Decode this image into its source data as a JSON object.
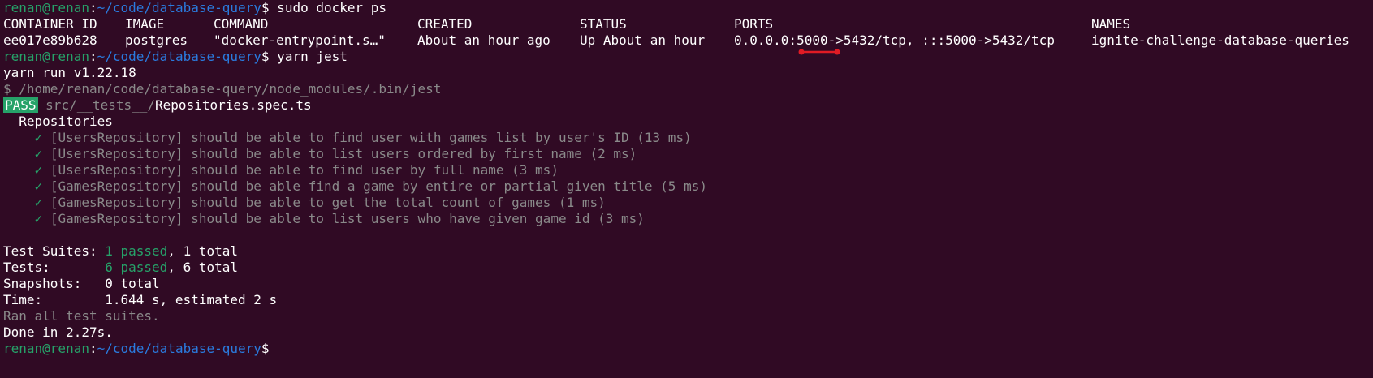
{
  "prompt": {
    "user_host": "renan@renan",
    "sep": ":",
    "path": "~/code/database-query",
    "symbol": "$"
  },
  "commands": {
    "cmd1": " sudo docker ps",
    "cmd2": " yarn jest"
  },
  "docker_ps": {
    "headers": [
      "CONTAINER ID",
      "IMAGE",
      "COMMAND",
      "CREATED",
      "STATUS",
      "PORTS",
      "NAMES"
    ],
    "row": [
      "ee017e89b628",
      "postgres",
      "\"docker-entrypoint.s…\"",
      "About an hour ago",
      "Up About an hour",
      "0.0.0.0:5000->5432/tcp, :::5000->5432/tcp",
      "ignite-challenge-database-queries"
    ]
  },
  "yarn": {
    "version_line": "yarn run v1.22.18",
    "bin_line": "$ /home/renan/code/database-query/node_modules/.bin/jest",
    "pass_label": "PASS",
    "spec_dir": "src/__tests__/",
    "spec_file": "Repositories.spec.ts",
    "suite_name": "Repositories",
    "check_mark": "✓",
    "tests": [
      "[UsersRepository] should be able to find user with games list by user's ID (13 ms)",
      "[UsersRepository] should be able to list users ordered by first name (2 ms)",
      "[UsersRepository] should be able to find user by full name (3 ms)",
      "[GamesRepository] should be able find a game by entire or partial given title (5 ms)",
      "[GamesRepository] should be able to get the total count of games (1 ms)",
      "[GamesRepository] should be able to list users who have given game id (3 ms)"
    ]
  },
  "summary": {
    "suites_label": "Test Suites: ",
    "suites_passed": "1 passed",
    "suites_total": ", 1 total",
    "tests_label": "Tests:       ",
    "tests_passed": "6 passed",
    "tests_total": ", 6 total",
    "snapshots": "Snapshots:   0 total",
    "time": "Time:        1.644 s, estimated 2 s",
    "ran_all": "Ran all test suites.",
    "done": "Done in 2.27s."
  },
  "colors": {
    "background": "#300a24",
    "prompt_user": "#26a269",
    "prompt_path": "#2a7bde",
    "pass_badge": "#26a269",
    "annotation": "#e01b24"
  }
}
